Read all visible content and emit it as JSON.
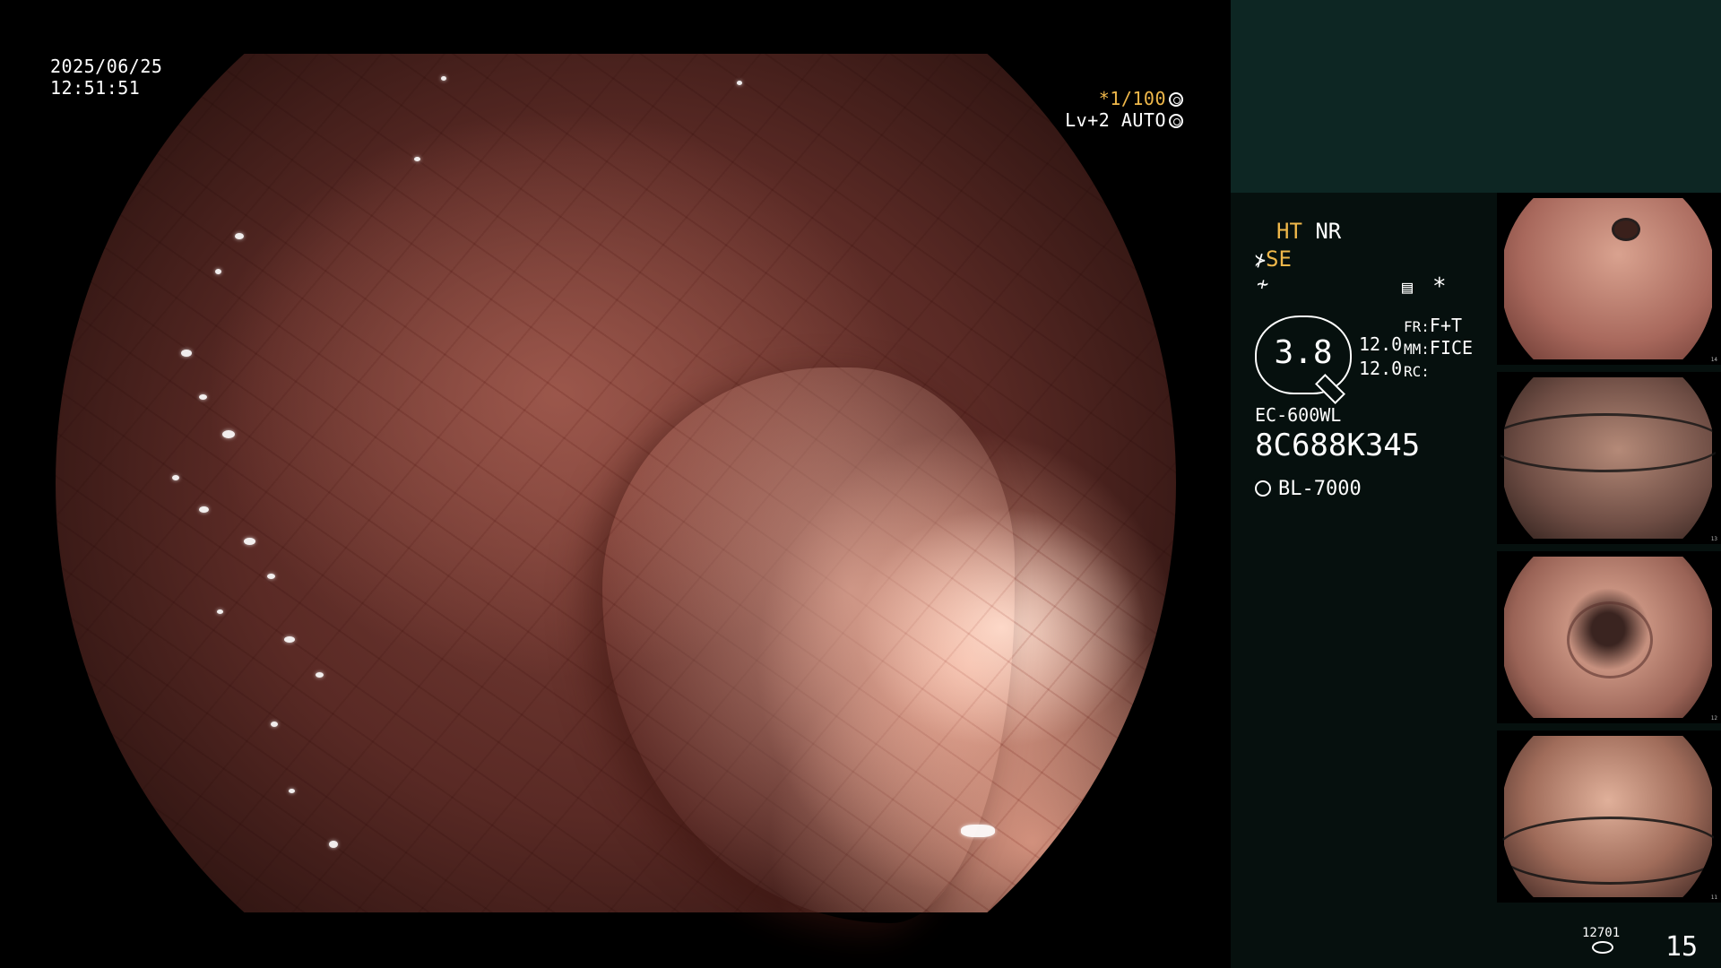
{
  "overlay": {
    "date": "2025/06/25",
    "time": "12:51:51",
    "shutter_speed": "*1/100",
    "enhancement": "Lv+2 AUTO"
  },
  "panel": {
    "ht": "HT",
    "nr": "NR",
    "se": "SE",
    "scope_value": "3.8",
    "value_a": "12.0",
    "value_b": "12.0",
    "fr_label": "FR:",
    "fr_value": "F+T",
    "mm_label": "MM:",
    "mm_value": "FICE",
    "rc_label": "RC:",
    "model": "EC-600WL",
    "serial": "8C688K345",
    "light_source": "BL-7000",
    "asterisk": "*",
    "storage_count": "12701",
    "frame_count": "15"
  },
  "thumbnails": [
    {
      "index": "14"
    },
    {
      "index": "13"
    },
    {
      "index": "12"
    },
    {
      "index": "11"
    }
  ],
  "colors": {
    "panel_bg": "#06100e",
    "panel_top_bg": "#0d2623",
    "accent_yellow": "#f0b84a"
  },
  "icons": [
    "shutter-icon",
    "enhance-icon",
    "se-icon",
    "flash-icon",
    "settings-list-icon",
    "light-source-icon",
    "disk-icon"
  ]
}
